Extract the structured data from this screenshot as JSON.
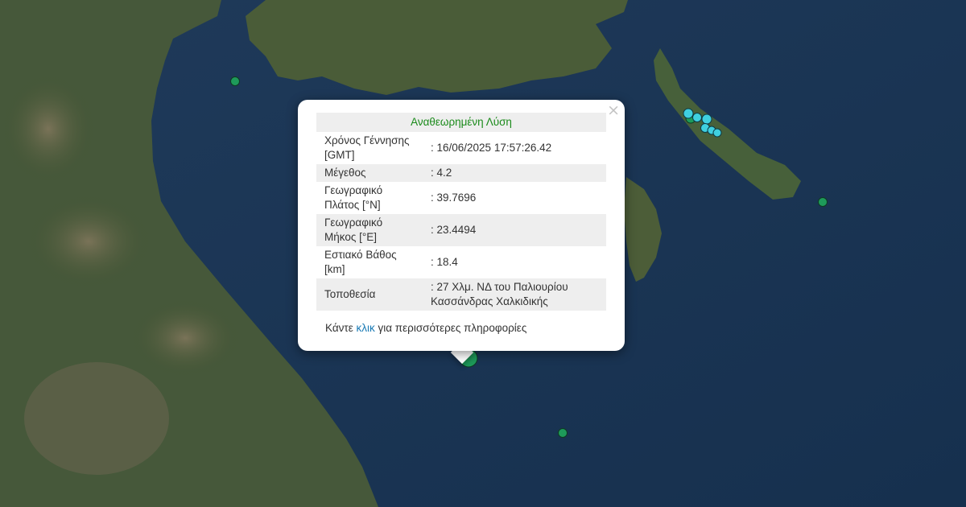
{
  "popup": {
    "title": "Αναθεωρημένη Λύση",
    "close_symbol": "×",
    "rows": [
      {
        "label": "Χρόνος Γέννησης [GMT]",
        "value": ": 16/06/2025 17:57:26.42"
      },
      {
        "label": "Μέγεθος",
        "value": ": 4.2"
      },
      {
        "label": "Γεωγραφικό Πλάτος [°N]",
        "value": ": 39.7696"
      },
      {
        "label": "Γεωγραφικό Μήκος [°E]",
        "value": ": 23.4494"
      },
      {
        "label": "Εστιακό Βάθος [km]",
        "value": ": 18.4"
      },
      {
        "label": "Τοποθεσία",
        "value": ": 27 Χλμ. ΝΔ του Παλιουρίου Κασσάνδρας Χαλκιδικής"
      }
    ],
    "more_prefix": "Κάντε ",
    "more_link": "κλικ",
    "more_suffix": " για περισσότερες πληροφορίες"
  },
  "colors": {
    "sea": "#1d3554",
    "land": "#4a5a34",
    "marker_green": "#1e9a5a",
    "marker_cyan": "#3fd0e0",
    "title_green": "#1a8a1a",
    "link_blue": "#1a7ab5"
  },
  "icons": {
    "close": "close-icon",
    "marker": "earthquake-marker-icon"
  }
}
